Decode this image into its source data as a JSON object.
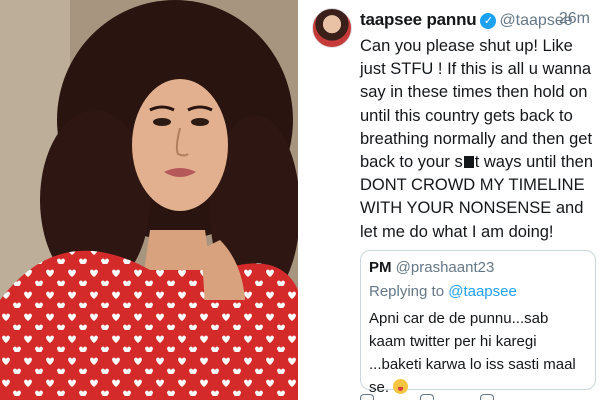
{
  "tweet": {
    "author_name": "taapsee pannu",
    "verified_icon": "verified-badge-icon",
    "handle": "@taapsee",
    "time": "26m",
    "text_part1": "Can you please shut up! Like just STFU ! If this is all u wanna say in these times then hold on until this country gets back to breathing normally and then get back to your s",
    "text_part2": "t ways until then DONT CROWD MY TIMELINE WITH YOUR NONSENSE and let me do what I am doing!"
  },
  "quote": {
    "author_name": "PM",
    "handle": "@prashaant23",
    "replying_prefix": "Replying to ",
    "replying_to": "@taapsee",
    "text": "Apni car de de punnu...sab kaam twitter per hi karegi ...baketi karwa lo iss sasti maal se.",
    "emoji": "grinning-face-with-tongue-emoji"
  },
  "colors": {
    "link_blue": "#1da1f2",
    "text_dark": "#14171a",
    "text_gray": "#657786",
    "dress_red": "#d42a2a"
  }
}
